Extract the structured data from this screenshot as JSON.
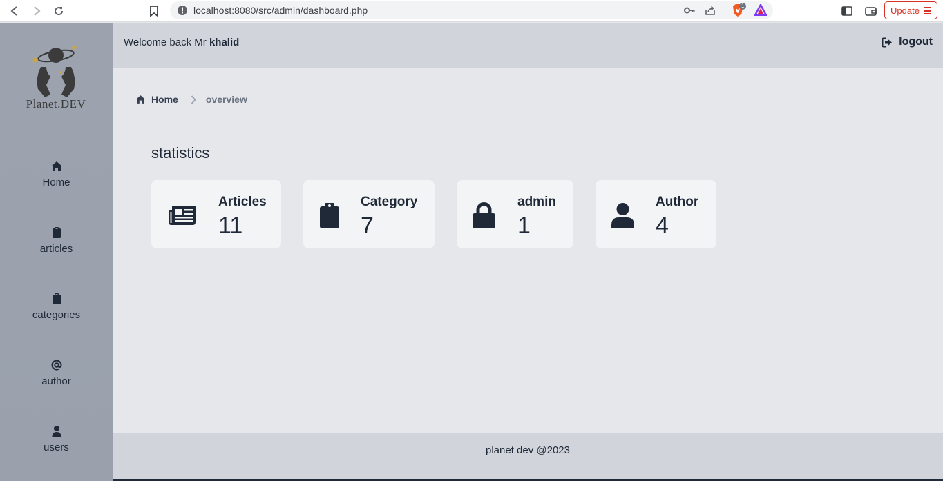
{
  "browser": {
    "url": "localhost:8080/src/admin/dashboard.php",
    "update_label": "Update",
    "shields_badge": "1"
  },
  "sidebar": {
    "logo_text": "Planet.DEV",
    "items": [
      {
        "label": "Home",
        "icon": "home-icon"
      },
      {
        "label": "articles",
        "icon": "clipboard-icon"
      },
      {
        "label": "categories",
        "icon": "clipboard-icon"
      },
      {
        "label": "author",
        "icon": "at-icon"
      },
      {
        "label": "users",
        "icon": "user-icon"
      }
    ]
  },
  "header": {
    "welcome_prefix": "Welcome back Mr",
    "username": "khalid",
    "logout_label": "logout"
  },
  "breadcrumb": {
    "home": "Home",
    "current": "overview"
  },
  "main": {
    "section_title": "statistics",
    "stats": [
      {
        "label": "Articles",
        "value": "11",
        "icon": "newspaper-icon"
      },
      {
        "label": "Category",
        "value": "7",
        "icon": "clipboard-icon"
      },
      {
        "label": "admin",
        "value": "1",
        "icon": "lock-icon"
      },
      {
        "label": "Author",
        "value": "4",
        "icon": "user-icon"
      }
    ]
  },
  "footer": {
    "text": "planet dev @2023"
  },
  "colors": {
    "sidebar_bg": "#9ca3af",
    "header_bg": "#d1d5db",
    "page_bg": "#e5e7eb",
    "card_bg": "#f3f4f6",
    "text_dark": "#1f2937",
    "update_red": "#d93025"
  }
}
